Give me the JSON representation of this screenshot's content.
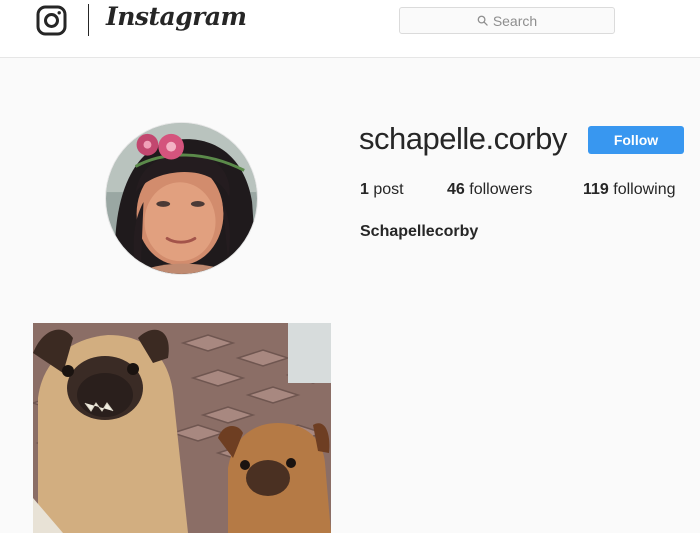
{
  "app": {
    "name": "Instagram"
  },
  "search": {
    "placeholder": "Search"
  },
  "profile": {
    "username": "schapelle.corby",
    "follow_label": "Follow",
    "posts_count": "1",
    "posts_label": "post",
    "followers_count": "46",
    "followers_label": "followers",
    "following_count": "119",
    "following_label": "following",
    "full_name": "Schapellecorby"
  },
  "colors": {
    "follow_button": "#3897f0",
    "text": "#262626",
    "background": "#fafafa"
  },
  "icons": {
    "logo": "instagram-camera-icon",
    "search": "search-icon"
  }
}
